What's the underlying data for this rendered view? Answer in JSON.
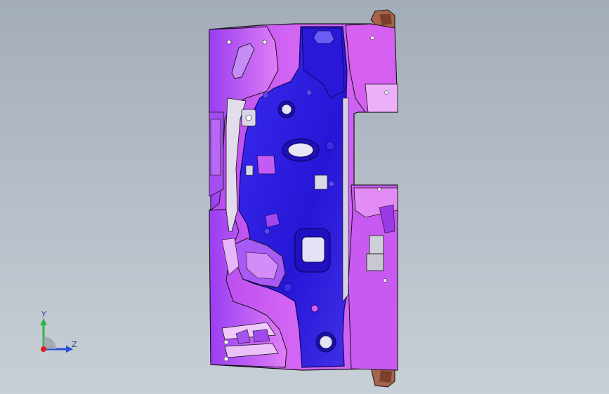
{
  "viewport": {
    "background_top": "#a3acb9",
    "background_bottom": "#c9cfd6"
  },
  "model": {
    "icon": "sheet-metal-part-icon",
    "colors": {
      "blue_surface": "#2d1fe0",
      "blue_dark": "#1a0fa8",
      "magenta_surface": "#c94cf2",
      "magenta_light": "#e58ff5",
      "violet_surface": "#8a37f0",
      "edge": "#141414",
      "bracket": "#a8644a"
    }
  },
  "triad": {
    "y_label": "Y",
    "z_label": "Z",
    "y_color": "#2fb24a",
    "z_color": "#2350d8",
    "x_color": "#e02020"
  }
}
